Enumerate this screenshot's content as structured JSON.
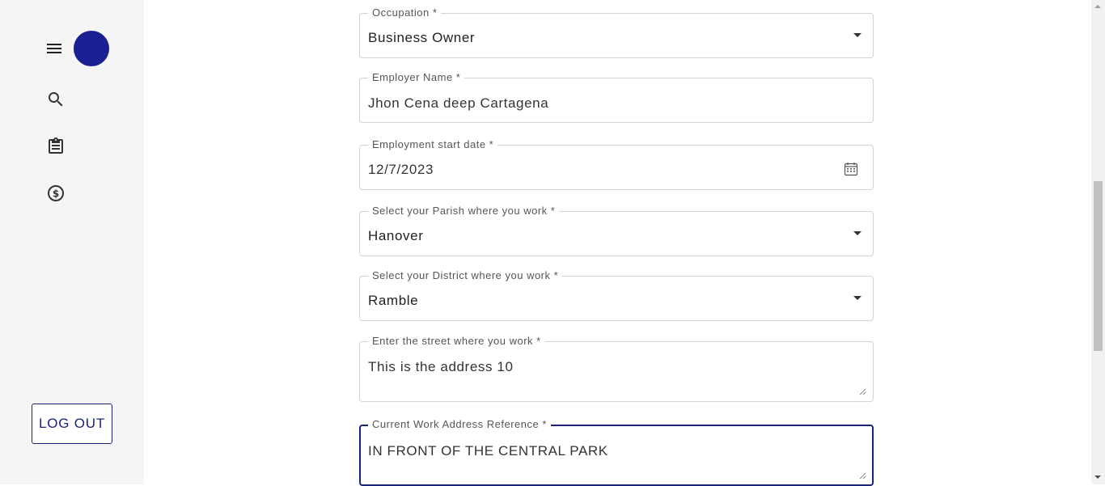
{
  "sidebar": {
    "menu_icon": "menu-icon",
    "avatar_color": "#1a1f94",
    "nav_icons": [
      "search-icon",
      "clipboard-icon",
      "dollar-circle-icon"
    ],
    "logout_label": "LOG OUT"
  },
  "form": {
    "occupation": {
      "label": "Occupation *",
      "value": "Business Owner"
    },
    "employer_name": {
      "label": "Employer Name *",
      "value": "Jhon Cena deep Cartagena"
    },
    "employment_start_date": {
      "label": "Employment start date *",
      "value": "12/7/2023"
    },
    "parish": {
      "label": "Select your Parish where you work *",
      "value": "Hanover"
    },
    "district": {
      "label": "Select your District where you work *",
      "value": "Ramble"
    },
    "street": {
      "label": "Enter the street where you work *",
      "value": "This is the address 10"
    },
    "address_reference": {
      "label": "Current Work Address Reference *",
      "value": "IN FRONT OF THE CENTRAL PARK"
    }
  },
  "colors": {
    "accent": "#1a237e",
    "sidebar_bg": "#f5f5f5"
  }
}
